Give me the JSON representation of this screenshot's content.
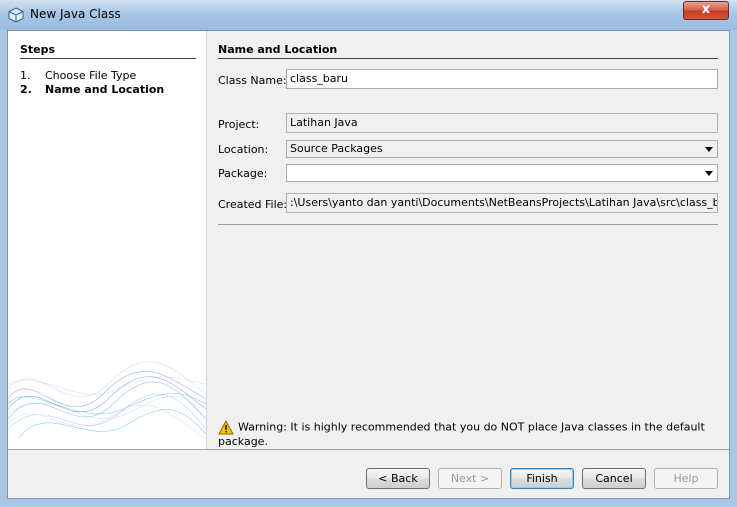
{
  "window": {
    "title": "New Java Class",
    "close_glyph": "x"
  },
  "steps": {
    "title": "Steps",
    "items": [
      {
        "num": "1.",
        "label": "Choose File Type"
      },
      {
        "num": "2.",
        "label": "Name and Location"
      }
    ]
  },
  "panel": {
    "title": "Name and Location",
    "class_name": {
      "label": "Class Name:",
      "value": "class_baru"
    },
    "project": {
      "label": "Project:",
      "value": "Latihan Java"
    },
    "location": {
      "label": "Location:",
      "value": "Source Packages"
    },
    "package": {
      "label": "Package:",
      "value": ""
    },
    "created_file": {
      "label": "Created File:",
      "value": ":\\Users\\yanto dan yanti\\Documents\\NetBeansProjects\\Latihan Java\\src\\class_baru.java"
    },
    "warning": "Warning: It is highly recommended that you do NOT place Java classes in the default package."
  },
  "buttons": {
    "back": "< Back",
    "next": "Next >",
    "finish": "Finish",
    "cancel": "Cancel",
    "help": "Help"
  },
  "colors": {
    "accent": "#3c7fb1",
    "warning": "#f5c400"
  }
}
